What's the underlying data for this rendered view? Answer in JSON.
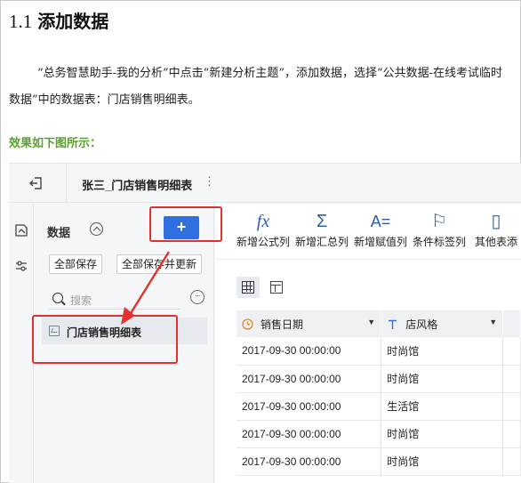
{
  "heading": {
    "number": "1.1",
    "text": "添加数据"
  },
  "paragraph": "“总务智慧助手-我的分析”中点击“新建分析主题”，添加数据，选择“公共数据-在线考试临时数据”中的数据表：门店销售明细表。",
  "effect_label": "效果如下图所示：",
  "app": {
    "doc_title": "张三_门店销售明细表",
    "kebab": "⋮",
    "data_panel": {
      "title": "数据",
      "add_button": "+",
      "save_all": "全部保存",
      "save_all_update": "全部保存并更新",
      "search_placeholder": "搜索",
      "more": "···",
      "table_item": "门店销售明细表"
    },
    "toolbar": [
      {
        "icon": "fx-icon",
        "glyph": "fx",
        "label": "新增公式列"
      },
      {
        "icon": "sigma-icon",
        "glyph": "Σ",
        "label": "新增汇总列"
      },
      {
        "icon": "assign-icon",
        "glyph": "A=",
        "label": "新增赋值列"
      },
      {
        "icon": "flag-icon",
        "glyph": "⚐",
        "label": "条件标签列"
      },
      {
        "icon": "table-add-icon",
        "glyph": "▯",
        "label": "其他表添"
      }
    ],
    "columns": [
      {
        "icon": "clock-icon",
        "label": "销售日期"
      },
      {
        "icon": "text-type-icon",
        "label": "店风格"
      }
    ],
    "rows": [
      [
        "2017-09-30 00:00:00",
        "时尚馆"
      ],
      [
        "2017-09-30 00:00:00",
        "时尚馆"
      ],
      [
        "2017-09-30 00:00:00",
        "生活馆"
      ],
      [
        "2017-09-30 00:00:00",
        "时尚馆"
      ],
      [
        "2017-09-30 00:00:00",
        "时尚馆"
      ]
    ],
    "colors": {
      "accent": "#2f6fe0",
      "highlight": "#e5312e",
      "icon_blue": "#2f5ea8",
      "effect_green": "#5aa02c"
    }
  }
}
